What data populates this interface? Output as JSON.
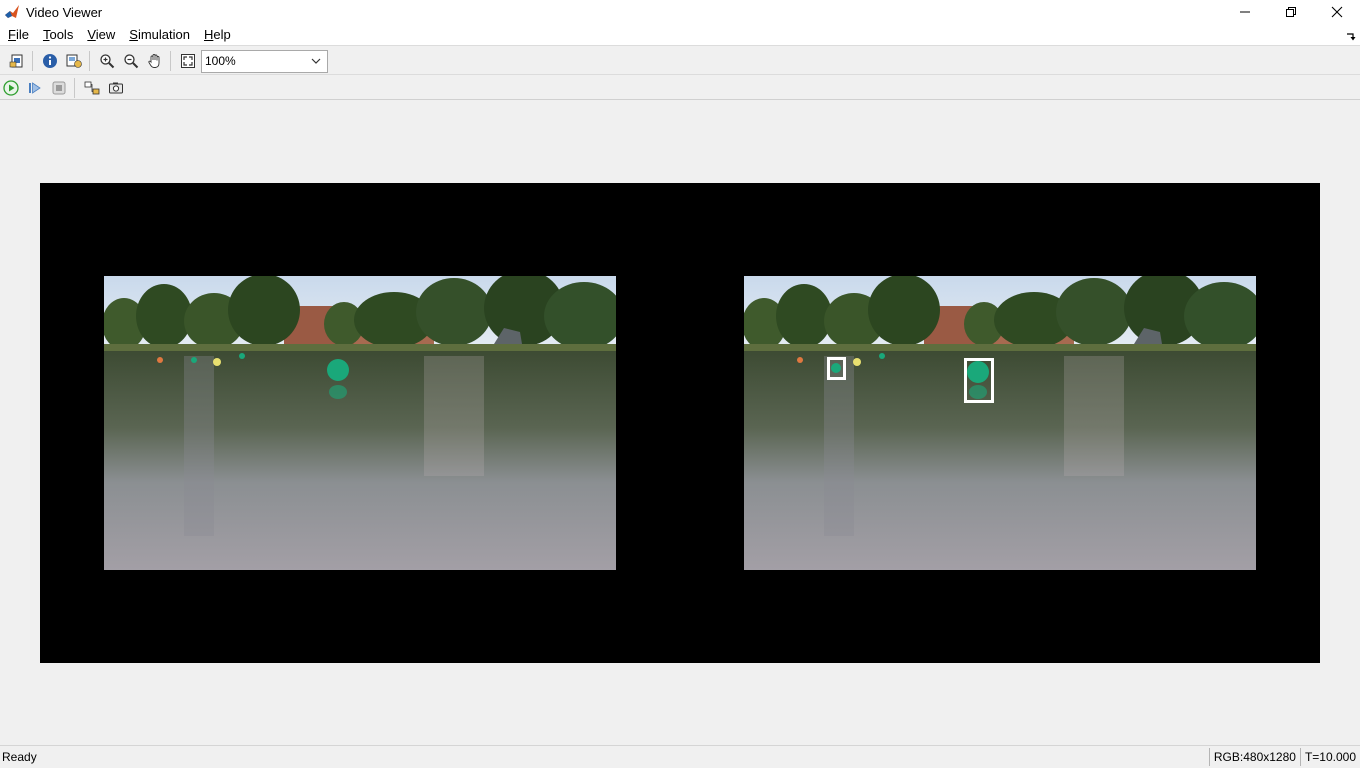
{
  "window": {
    "title": "Video Viewer"
  },
  "menu": {
    "items": [
      {
        "label": "File",
        "mnemonic": "F"
      },
      {
        "label": "Tools",
        "mnemonic": "T"
      },
      {
        "label": "View",
        "mnemonic": "V"
      },
      {
        "label": "Simulation",
        "mnemonic": "S"
      },
      {
        "label": "Help",
        "mnemonic": "H"
      }
    ]
  },
  "toolbar": {
    "zoom_value": "100%",
    "icons": [
      "print-to-figure-icon",
      "info-icon",
      "video-info-icon",
      "zoom-in-icon",
      "zoom-out-icon",
      "pan-hand-icon",
      "fit-to-view-icon"
    ],
    "playback_icons": [
      "play-icon",
      "step-forward-icon",
      "stop-icon",
      "highlight-block-icon",
      "snapshot-icon"
    ]
  },
  "colors": {
    "background": "#f0f0f0",
    "canvas": "#000000",
    "bbox": "#ffffff",
    "buoy": "#1aa87a",
    "play_green": "#2e9e2e"
  },
  "status": {
    "text": "Ready",
    "dimensions": "RGB:480x1280",
    "time": "T=10.000"
  }
}
